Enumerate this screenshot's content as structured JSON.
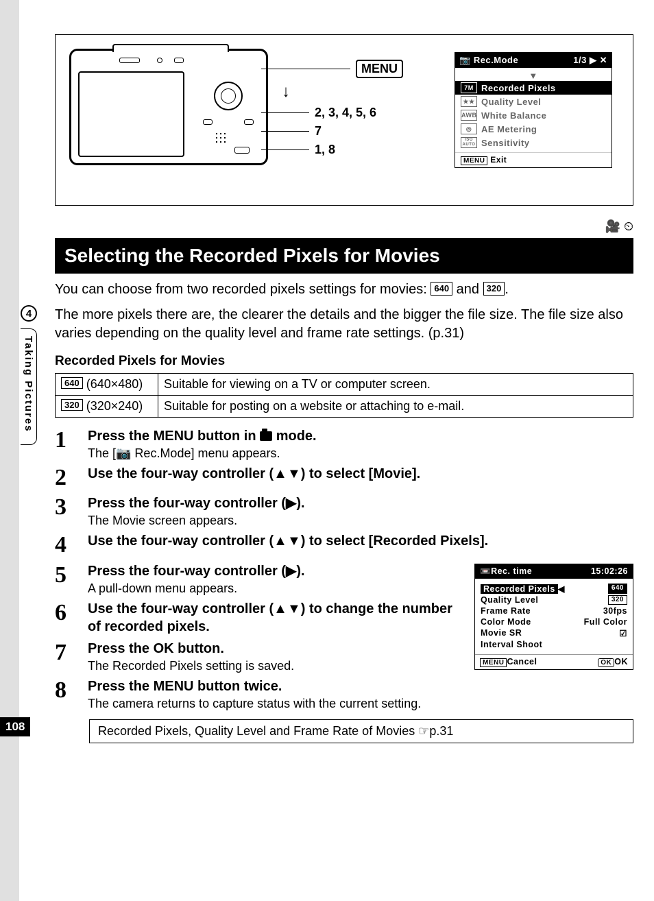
{
  "page_number": "108",
  "chapter": {
    "num": "4",
    "title": "Taking Pictures"
  },
  "top_diagram": {
    "menu_label": "MENU",
    "leads": [
      "2, 3, 4, 5, 6",
      "7",
      "1, 8"
    ]
  },
  "rec_mode_panel": {
    "title": "Rec.Mode",
    "page_indicator": "1/3",
    "items": [
      {
        "icon": "7M",
        "label": "Recorded Pixels",
        "selected": true
      },
      {
        "icon": "★★",
        "label": "Quality Level"
      },
      {
        "icon": "AWB",
        "label": "White Balance"
      },
      {
        "icon": "◎",
        "label": "AE Metering"
      },
      {
        "icon": "ISO AUTO",
        "label": "Sensitivity"
      }
    ],
    "footer_btn": "MENU",
    "footer_label": "Exit"
  },
  "icons_bar": {
    "movie_icon": "🎥",
    "interval_icon": "⏲"
  },
  "heading": "Selecting the Recorded Pixels for Movies",
  "intro": {
    "part1": "You can choose from two recorded pixels settings for movies: ",
    "tag1": "640",
    "mid": " and ",
    "tag2": "320",
    "end": ".",
    "para2": "The more pixels there are, the clearer the details and the bigger the file size. The file size also varies depending on the quality level and frame rate settings. (p.31)"
  },
  "table_title": "Recorded Pixels for Movies",
  "table": [
    {
      "tag": "640",
      "dim": "(640×480)",
      "desc": "Suitable for viewing on a TV or computer screen."
    },
    {
      "tag": "320",
      "dim": "(320×240)",
      "desc": "Suitable for posting on a website or attaching to e-mail."
    }
  ],
  "steps": [
    {
      "n": "1",
      "title_pre": "Press the ",
      "title_bold": "MENU",
      "title_post": " button in ",
      "title_icon": true,
      "title_end": " mode.",
      "desc": "The [📷 Rec.Mode] menu appears."
    },
    {
      "n": "2",
      "title": "Use the four-way controller (▲▼) to select [Movie]."
    },
    {
      "n": "3",
      "title": "Press the four-way controller (▶).",
      "desc": "The Movie screen appears."
    },
    {
      "n": "4",
      "title": "Use the four-way controller (▲▼) to select [Recorded Pixels]."
    },
    {
      "n": "5",
      "title": "Press the four-way controller (▶).",
      "desc": "A pull-down menu appears."
    },
    {
      "n": "6",
      "title": "Use the four-way controller (▲▼) to change the number of recorded pixels."
    },
    {
      "n": "7",
      "title_pre": "Press the ",
      "title_bold": "OK",
      "title_post": " button.",
      "desc": "The Recorded Pixels setting is saved."
    },
    {
      "n": "8",
      "title_pre": "Press the ",
      "title_bold": "MENU",
      "title_post": " button twice.",
      "desc": "The camera returns to capture status with the current setting."
    }
  ],
  "movie_panel": {
    "header_left": "Rec. time",
    "header_right": "15:02:26",
    "rows": [
      {
        "label": "Recorded Pixels",
        "value": "640",
        "hl": true,
        "arrow": "◀"
      },
      {
        "label": "Quality Level",
        "value": "320",
        "boxed": true
      },
      {
        "label": "Frame Rate",
        "value": "30fps"
      },
      {
        "label": "Color Mode",
        "value": "Full Color"
      },
      {
        "label": "Movie SR",
        "value": "☑"
      },
      {
        "label": "Interval Shoot",
        "value": ""
      }
    ],
    "footer_left_btn": "MENU",
    "footer_left": "Cancel",
    "footer_right_btn": "OK",
    "footer_right": "OK"
  },
  "xref": "Recorded Pixels, Quality Level and Frame Rate of Movies ☞p.31"
}
